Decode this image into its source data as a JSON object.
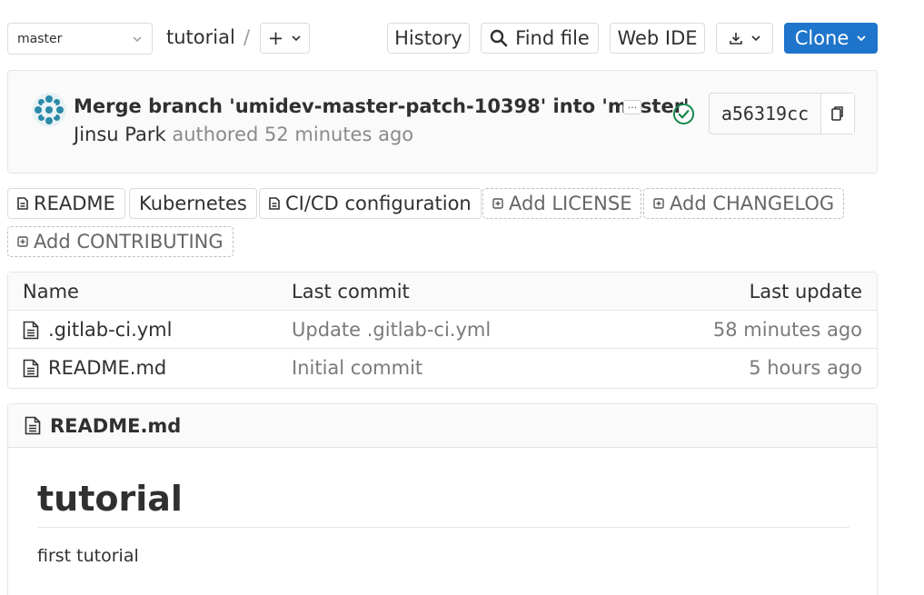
{
  "toolbar": {
    "branch": "master",
    "project": "tutorial",
    "separator": "/",
    "plus": "+",
    "history": "History",
    "find_file": "Find file",
    "web_ide": "Web IDE",
    "clone": "Clone",
    "clone_color": "#1f75cb"
  },
  "commit": {
    "title": "Merge branch 'umidev-master-patch-10398' into 'master'",
    "ellipsis": "...",
    "author": "Jinsu Park",
    "authored": "authored 52 minutes ago",
    "sha": "a56319cc",
    "status": "success",
    "status_color": "#108548"
  },
  "shortcuts": [
    {
      "label": "README",
      "icon": "file-icon"
    },
    {
      "label": "Kubernetes"
    },
    {
      "label": "CI/CD configuration",
      "icon": "file-icon"
    },
    {
      "label": "Add LICENSE",
      "icon": "plus-square-icon"
    },
    {
      "label": "Add CHANGELOG",
      "icon": "plus-square-icon"
    },
    {
      "label": "Add CONTRIBUTING",
      "icon": "plus-square-icon"
    }
  ],
  "table": {
    "headers": {
      "name": "Name",
      "last_commit": "Last commit",
      "last_update": "Last update"
    },
    "rows": [
      {
        "name": ".gitlab-ci.yml",
        "commit": "Update .gitlab-ci.yml",
        "updated": "58 minutes ago"
      },
      {
        "name": "README.md",
        "commit": "Initial commit",
        "updated": "5 hours ago"
      }
    ]
  },
  "readme": {
    "filename": "README.md",
    "heading": "tutorial",
    "body": "first tutorial"
  }
}
